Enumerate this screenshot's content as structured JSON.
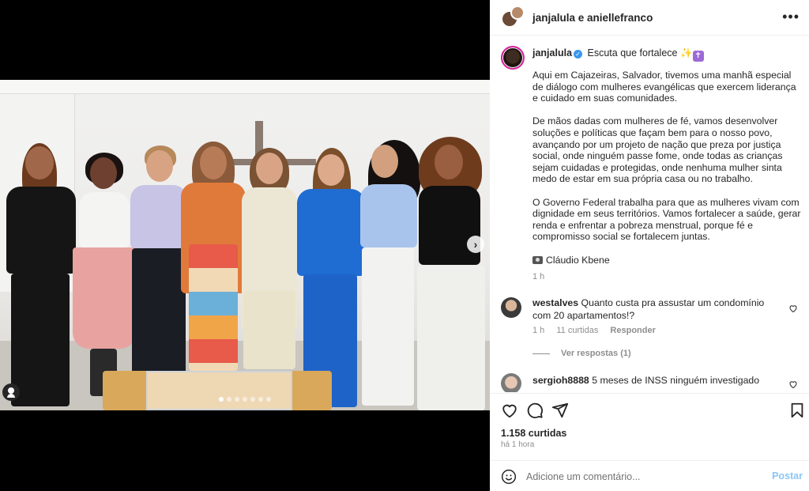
{
  "header": {
    "title": "janjalula e aniellefranco"
  },
  "caption": {
    "username": "janjalula",
    "headline": "Escuta que fortalece",
    "paragraphs": [
      "Aqui em Cajazeiras, Salvador, tivemos uma manhã especial de diálogo com mulheres evangélicas que exercem liderança e cuidado em suas comunidades.",
      "De mãos dadas com mulheres de fé, vamos desenvolver soluções e políticas que façam bem para o nosso povo, avançando por um projeto de nação que preza por justiça social, onde ninguém passe fome, onde todas as crianças sejam cuidadas e protegidas, onde nenhuma mulher sinta medo de estar em sua própria casa ou no trabalho.",
      "O Governo Federal trabalha para que as mulheres vivam com dignidade em seus territórios. Vamos fortalecer a saúde, gerar renda e enfrentar a pobreza menstrual, porque fé e compromisso social se fortalecem juntas."
    ],
    "credit": "Cláudio Kbene",
    "time": "1 h"
  },
  "comments": [
    {
      "username": "westalves",
      "text": "Quanto custa pra assustar um condomínio com 20 apartamentos!?",
      "time": "1 h",
      "likes": "11 curtidas",
      "reply_label": "Responder",
      "view_replies": "Ver respostas (1)"
    },
    {
      "username": "sergioh8888",
      "text": "5 meses de INSS ninguém investigado"
    }
  ],
  "post": {
    "likes": "1.158 curtidas",
    "time_ago": "há 1 hora",
    "carousel_count": 7,
    "carousel_active": 1
  },
  "composer": {
    "placeholder": "Adicione um comentário...",
    "post_label": "Postar"
  },
  "colors": {
    "link_blue": "#8cc6f7",
    "verified": "#3897f0",
    "muted": "#8e8e8e"
  }
}
